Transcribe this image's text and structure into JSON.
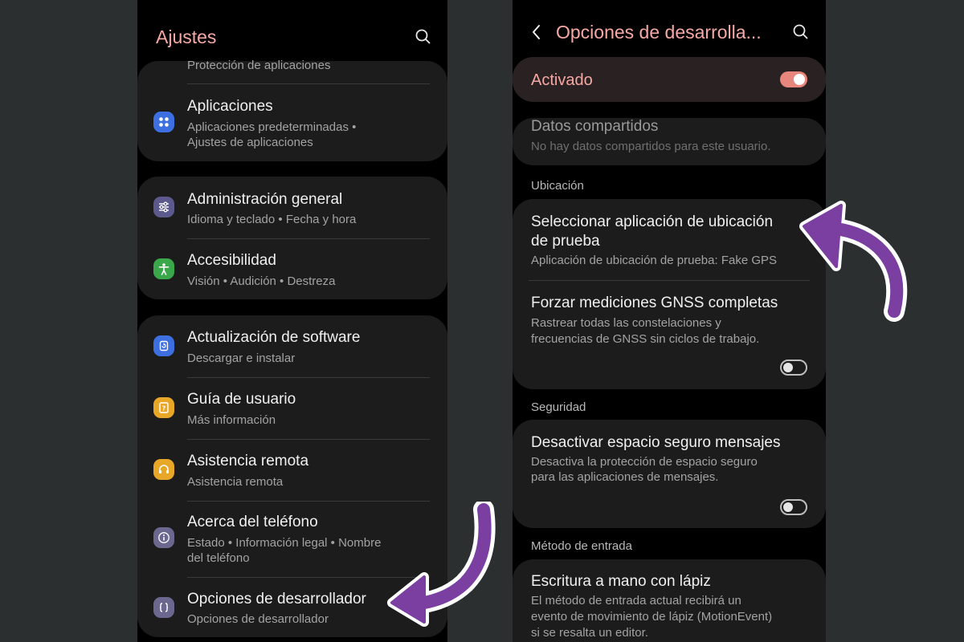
{
  "colors": {
    "background": "#2b2f30",
    "phone_bg": "#000000",
    "card_bg": "#1c1c1c",
    "accent": "#f6a9a4",
    "toggle_on": "#e8857c",
    "arrow_purple": "#7a3fa0"
  },
  "left": {
    "header_title": "Ajustes",
    "partial_item": "Protección de aplicaciones",
    "apps": {
      "icon": "apps-grid-icon",
      "title": "Aplicaciones",
      "sub1": "Aplicaciones predeterminadas  •",
      "sub2": "Ajustes de aplicaciones"
    },
    "general_admin": {
      "icon": "sliders-icon",
      "title": "Administración general",
      "sub": "Idioma y teclado  •  Fecha y hora"
    },
    "accessibility": {
      "icon": "accessibility-icon",
      "title": "Accesibilidad",
      "sub": "Visión  •  Audición  •  Destreza"
    },
    "software_update": {
      "icon": "software-update-icon",
      "title": "Actualización de software",
      "sub": "Descargar e instalar"
    },
    "user_guide": {
      "icon": "user-guide-icon",
      "title": "Guía de usuario",
      "sub": "Más información"
    },
    "remote_support": {
      "icon": "headset-icon",
      "title": "Asistencia remota",
      "sub": "Asistencia remota"
    },
    "about_phone": {
      "icon": "info-icon",
      "title": "Acerca del teléfono",
      "sub1": "Estado  •  Información legal  •  Nombre",
      "sub2": "del teléfono"
    },
    "developer_options": {
      "icon": "developer-braces-icon",
      "title": "Opciones de desarrollador",
      "sub": "Opciones de desarrollador"
    }
  },
  "right": {
    "header_title": "Opciones de desarrolla...",
    "activated_label": "Activado",
    "activated_on": true,
    "shared_data": {
      "title": "Datos compartidos",
      "sub": "No hay datos compartidos para este usuario."
    },
    "location_section": "Ubicación",
    "mock_location": {
      "title1": "Seleccionar aplicación de ubicación",
      "title2": "de prueba",
      "sub": "Aplicación de ubicación de prueba: Fake GPS"
    },
    "gnss": {
      "title": "Forzar mediciones GNSS completas",
      "sub1": "Rastrear todas las constelaciones y",
      "sub2": "frecuencias de GNSS sin ciclos de trabajo.",
      "on": false
    },
    "security_section": "Seguridad",
    "secure_space": {
      "title": "Desactivar espacio seguro mensajes",
      "sub1": "Desactiva la protección de espacio seguro",
      "sub2": "para las aplicaciones de mensajes.",
      "on": false
    },
    "input_section": "Método de entrada",
    "stylus": {
      "title": "Escritura a mano con lápiz",
      "sub1": "El método de entrada actual recibirá un",
      "sub2": "evento de movimiento de lápiz (MotionEvent)",
      "sub3": "si se resalta un editor."
    }
  }
}
